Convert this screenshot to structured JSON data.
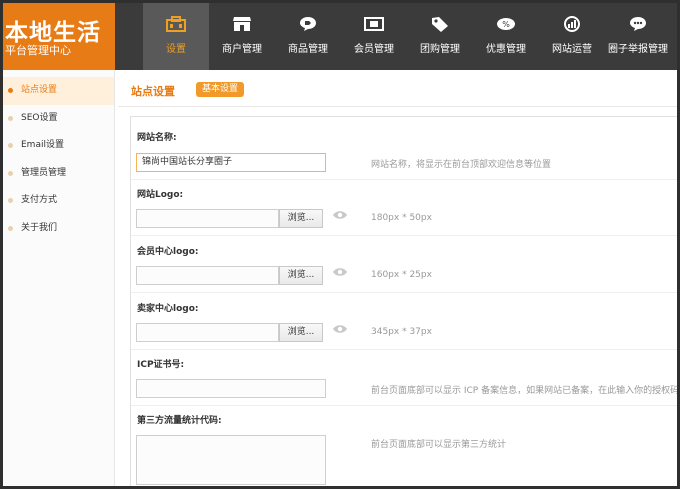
{
  "logo": {
    "title": "本地生活",
    "subtitle": "平台管理中心"
  },
  "nav": {
    "items": [
      {
        "label": "设置",
        "icon": "toolbox-icon",
        "active": true
      },
      {
        "label": "商户管理",
        "icon": "storefront-icon",
        "active": false
      },
      {
        "label": "商品管理",
        "icon": "tag-bubble-icon",
        "active": false
      },
      {
        "label": "会员管理",
        "icon": "member-card-icon",
        "active": false
      },
      {
        "label": "团购管理",
        "icon": "price-tag-icon",
        "active": false
      },
      {
        "label": "优惠管理",
        "icon": "coupon-icon",
        "active": false
      },
      {
        "label": "网站运营",
        "icon": "chart-cycle-icon",
        "active": false
      },
      {
        "label": "圈子举报管理",
        "icon": "chat-bubble-icon",
        "active": false
      }
    ]
  },
  "sidebar": {
    "items": [
      {
        "label": "站点设置",
        "active": true
      },
      {
        "label": "SEO设置",
        "active": false
      },
      {
        "label": "Email设置",
        "active": false
      },
      {
        "label": "管理员管理",
        "active": false
      },
      {
        "label": "支付方式",
        "active": false
      },
      {
        "label": "关于我们",
        "active": false
      }
    ]
  },
  "main": {
    "title": "站点设置",
    "tag": "基本设置"
  },
  "form": {
    "site_name": {
      "label": "网站名称:",
      "value": "锦尚中国站长分享圈子",
      "hint": "网站名称，将显示在前台顶部欢迎信息等位置"
    },
    "site_logo": {
      "label": "网站Logo:",
      "browse": "浏览...",
      "hint": "180px * 50px"
    },
    "member_logo": {
      "label": "会员中心logo:",
      "browse": "浏览...",
      "hint": "160px * 25px"
    },
    "seller_logo": {
      "label": "卖家中心logo:",
      "browse": "浏览...",
      "hint": "345px * 37px"
    },
    "icp": {
      "label": "ICP证书号:",
      "hint": "前台页面底部可以显示 ICP 备案信息，如果网站已备案，在此输入你的授权码，"
    },
    "stats_code": {
      "label": "第三方流量统计代码:",
      "hint": "前台页面底部可以显示第三方统计"
    }
  },
  "colors": {
    "accent": "#e77b15",
    "topbar": "#3b3b3b",
    "nav_active": "#595959"
  }
}
